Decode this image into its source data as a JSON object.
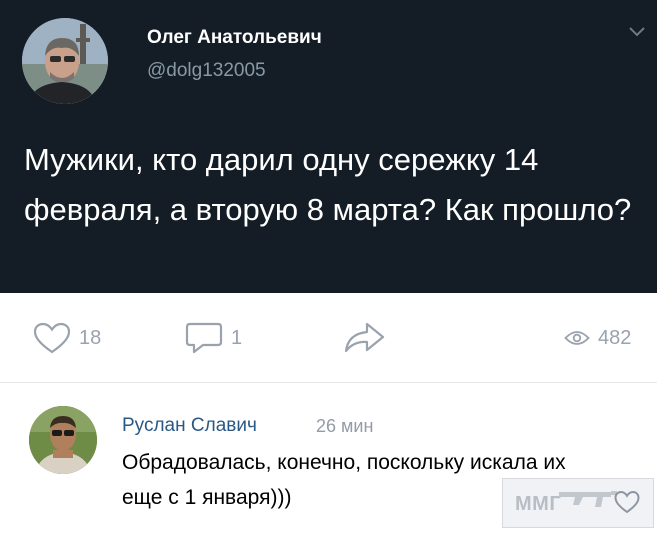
{
  "tweet": {
    "author_name": "Олег Анатольевич",
    "handle": "@dolg132005",
    "text": "Мужики, кто дарил одну сережку 14 февраля, а вторую 8 марта? Как прошло?"
  },
  "actions": {
    "likes": "18",
    "comments": "1",
    "views": "482"
  },
  "comment": {
    "author_name": "Руслан Славич",
    "time": "26 мин",
    "text": "Обрадовалась, конечно, поскольку искала их еще с 1 января)))"
  },
  "watermark": {
    "text": "ММГ"
  },
  "colors": {
    "tweet_background": "#141d26",
    "author_link": "#2a5885",
    "muted": "#99a2ad"
  },
  "icons": [
    "chevron-down-icon",
    "heart-icon",
    "comment-icon",
    "share-icon",
    "eye-icon",
    "rifle-icon"
  ]
}
